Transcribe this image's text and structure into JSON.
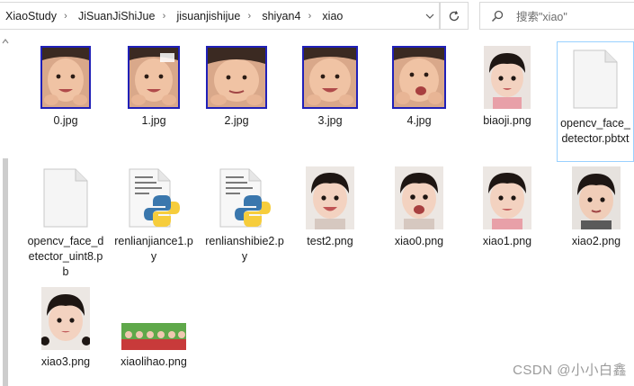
{
  "breadcrumb": [
    "XiaoStudy",
    "JiSuanJiShiJue",
    "jisuanjishijue",
    "shiyan4",
    "xiao"
  ],
  "search": {
    "placeholder": "搜索\"xiao\""
  },
  "files": [
    {
      "name": "0.jpg",
      "kind": "face-jpg",
      "icon": "photo-thumbnail-icon"
    },
    {
      "name": "1.jpg",
      "kind": "face-jpg",
      "icon": "photo-thumbnail-icon"
    },
    {
      "name": "2.jpg",
      "kind": "face-jpg",
      "icon": "photo-thumbnail-icon"
    },
    {
      "name": "3.jpg",
      "kind": "face-jpg",
      "icon": "photo-thumbnail-icon"
    },
    {
      "name": "4.jpg",
      "kind": "face-jpg",
      "icon": "photo-thumbnail-icon"
    },
    {
      "name": "biaoji.png",
      "kind": "portrait",
      "icon": "photo-thumbnail-icon"
    },
    {
      "name": "opencv_face_detector.pbtxt",
      "kind": "blank",
      "icon": "blank-file-icon"
    },
    {
      "name": "opencv_face_detector_uint8.pb",
      "kind": "blank",
      "icon": "blank-file-icon"
    },
    {
      "name": "renlianjiance1.py",
      "kind": "python",
      "icon": "python-file-icon"
    },
    {
      "name": "renlianshibie2.py",
      "kind": "python",
      "icon": "python-file-icon"
    },
    {
      "name": "test2.png",
      "kind": "portrait",
      "icon": "photo-thumbnail-icon"
    },
    {
      "name": "xiao0.png",
      "kind": "portrait",
      "icon": "photo-thumbnail-icon"
    },
    {
      "name": "xiao1.png",
      "kind": "portrait",
      "icon": "photo-thumbnail-icon"
    },
    {
      "name": "xiao2.png",
      "kind": "portrait",
      "icon": "photo-thumbnail-icon"
    },
    {
      "name": "xiao3.png",
      "kind": "portrait",
      "icon": "photo-thumbnail-icon"
    },
    {
      "name": "xiaolihao.png",
      "kind": "group",
      "icon": "photo-thumbnail-icon"
    }
  ],
  "watermark": "CSDN @小小白鑫",
  "colors": {
    "selection_border": "#99d1ff",
    "face_box": "#2020b8"
  }
}
